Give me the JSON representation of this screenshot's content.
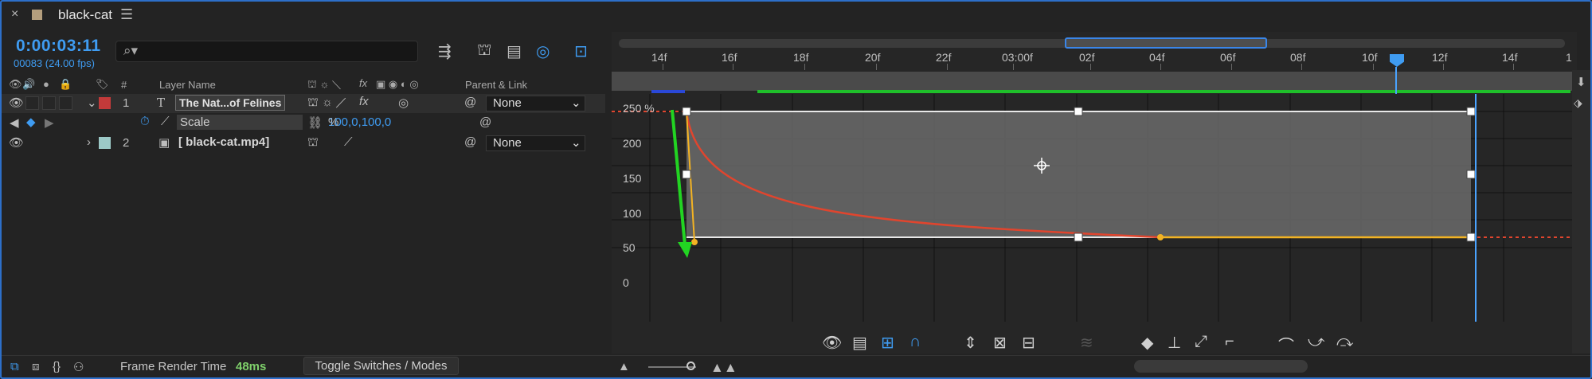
{
  "tab": {
    "title": "black-cat",
    "close": "×",
    "menu": "☰"
  },
  "time": {
    "timecode": "0:00:03:11",
    "frames_fps": "00083 (24.00 fps)"
  },
  "search": {
    "placeholder": ""
  },
  "columns": {
    "number": "#",
    "layer_name": "Layer Name",
    "parent_link": "Parent & Link",
    "fx": "fx"
  },
  "layers": [
    {
      "number": "1",
      "type_glyph": "T",
      "name": "The Nat...of Felines",
      "parent": "None",
      "label_color": "#c23a3a"
    },
    {
      "number": "2",
      "name": "[ black-cat.mp4]",
      "parent": "None",
      "label_color": "#9cc9c7"
    }
  ],
  "property": {
    "name": "Scale",
    "value": "100,0,100,0",
    "unit": "%"
  },
  "ruler": {
    "labels": [
      "14f",
      "16f",
      "18f",
      "20f",
      "22f",
      "03:00f",
      "02f",
      "04f",
      "06f",
      "08f",
      "10f",
      "12f",
      "14f"
    ],
    "trailing": "1"
  },
  "graph": {
    "y_labels": [
      "250 %",
      "200",
      "150",
      "100",
      "50",
      "0"
    ],
    "top_value_pct": 250,
    "bottom_value_pct": 100
  },
  "bottom": {
    "render_label": "Frame Render Time",
    "render_value": "48ms",
    "toggle_label": "Toggle Switches / Modes"
  },
  "colors": {
    "accent": "#3f9cf2",
    "curve": "#e0452e",
    "handle": "#f3b323",
    "green": "#1fbf2a"
  }
}
